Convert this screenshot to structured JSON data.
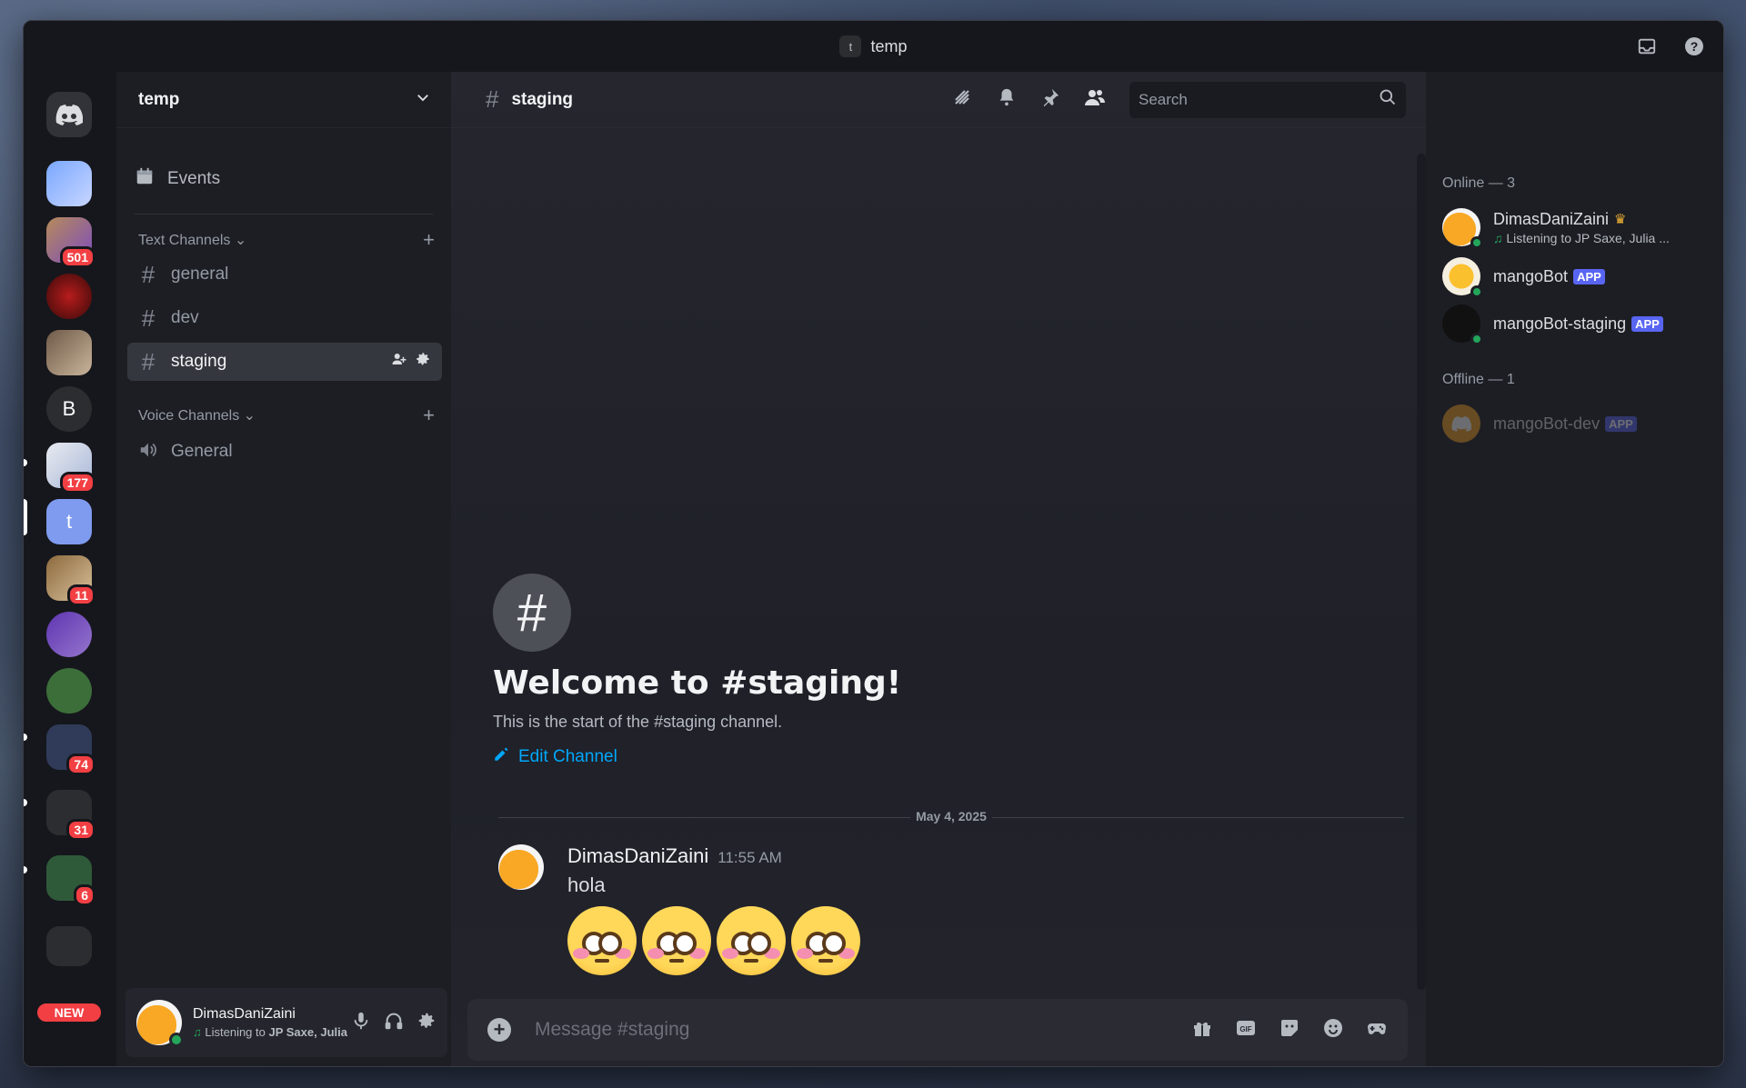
{
  "window": {
    "title": "temp",
    "title_chip": "t"
  },
  "rail": {
    "badges": [
      "501",
      "177",
      "11",
      "74",
      "31",
      "6"
    ],
    "letter_b": "B",
    "letter_t": "t",
    "new_label": "NEW"
  },
  "guild": {
    "name": "temp",
    "events_label": "Events"
  },
  "categories": {
    "text": "Text Channels",
    "voice": "Voice Channels"
  },
  "channels": {
    "text": [
      "general",
      "dev",
      "staging"
    ],
    "voice": [
      "General"
    ]
  },
  "user": {
    "name": "DimasDaniZaini",
    "status_prefix": "Listening to ",
    "status_bold": "JP Saxe, Julia M..."
  },
  "chat": {
    "channel": "staging",
    "search_placeholder": "Search",
    "welcome_title": "Welcome to #staging!",
    "welcome_sub": "This is the start of the #staging channel.",
    "edit_channel": "Edit Channel",
    "date": "May 4, 2025",
    "message": {
      "author": "DimasDaniZaini",
      "time": "11:55 AM",
      "text": "hola",
      "emoji_count": 4
    },
    "composer_placeholder": "Message #staging"
  },
  "members": {
    "online_title": "Online — 3",
    "offline_title": "Offline — 1",
    "online": [
      {
        "name": "DimasDaniZaini",
        "sub": "Listening to JP Saxe, Julia ...",
        "app": false
      },
      {
        "name": "mangoBot",
        "app": true
      },
      {
        "name": "mangoBot-staging",
        "app": true
      }
    ],
    "offline": [
      {
        "name": "mangoBot-dev",
        "app": true
      }
    ],
    "app_tag": "APP"
  },
  "colors": {
    "accent": "#5865f2",
    "online": "#23a55a",
    "link": "#00a8fc",
    "badge": "#f23f43"
  }
}
